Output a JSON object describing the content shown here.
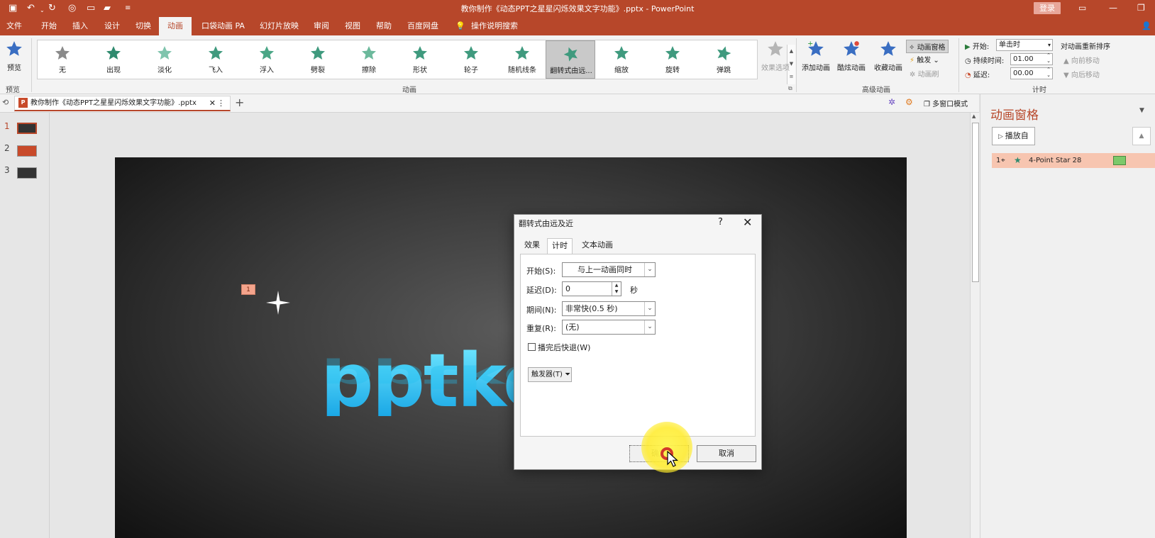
{
  "titlebar": {
    "title": "教你制作《动态PPT之星星闪烁效果文字功能》.pptx  -  PowerPoint",
    "login": "登录"
  },
  "tabs": [
    "文件",
    "开始",
    "插入",
    "设计",
    "切换",
    "动画",
    "口袋动画 PA",
    "幻灯片放映",
    "审阅",
    "视图",
    "帮助",
    "百度网盘",
    "操作说明搜索"
  ],
  "active_tab": "动画",
  "ribbon": {
    "preview": "预览",
    "preview_group": "预览",
    "animation_group": "动画",
    "gallery": [
      "无",
      "出现",
      "淡化",
      "飞入",
      "浮入",
      "劈裂",
      "擦除",
      "形状",
      "轮子",
      "随机线条",
      "翻转式由远...",
      "缩放",
      "旋转",
      "弹跳"
    ],
    "gallery_selected": "翻转式由远...",
    "effect_options": "效果选项",
    "advanced_group": "高级动画",
    "add_animation": "添加动画",
    "cool_animation": "酷炫动画",
    "fav_animation": "收藏动画",
    "anim_pane_btn": "动画窗格",
    "trigger": "触发",
    "anim_painter": "动画刷",
    "timing_group": "计时",
    "start_label": "开始:",
    "start_value": "单击时",
    "duration_label": "持续时间:",
    "duration_value": "01.00",
    "delay_label": "延迟:",
    "delay_value": "00.00",
    "reorder": "对动画重新排序",
    "move_earlier": "向前移动",
    "move_later": "向后移动"
  },
  "docstrip": {
    "doc_tab": "教你制作《动态PPT之星星闪烁效果文字功能》.pptx",
    "multiwindow": "多窗口模式"
  },
  "thumbs": [
    "1",
    "2",
    "3"
  ],
  "slide": {
    "text": "pptke",
    "anim_tag": "1"
  },
  "dialog": {
    "title": "翻转式由远及近",
    "help": "?",
    "close": "✕",
    "tabs": [
      "效果",
      "计时",
      "文本动画"
    ],
    "active_tab": "计时",
    "start_label": "开始(S):",
    "start_value": "与上一动画同时",
    "delay_label": "延迟(D):",
    "delay_value": "0",
    "delay_unit": "秒",
    "period_label": "期间(N):",
    "period_value": "非常快(0.5 秒)",
    "repeat_label": "重复(R):",
    "repeat_value": "(无)",
    "rewind_label": "播完后快退(W)",
    "trigger": "触发器(T)",
    "ok": "确定",
    "cancel": "取消"
  },
  "pane": {
    "title": "动画窗格",
    "play_from": "播放自",
    "item_index": "1",
    "item_name": "4-Point Star 28"
  },
  "colors": {
    "accent": "#b7472a",
    "star_green": "#3f9a7e",
    "selected_item": "#f7c5b0",
    "timeline_bar": "#7cc96a"
  }
}
